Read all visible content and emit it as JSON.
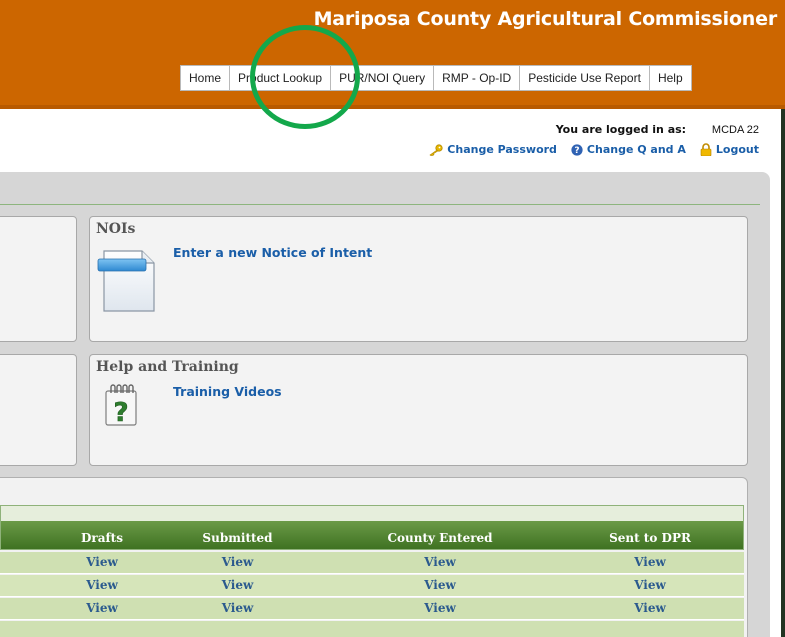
{
  "header": {
    "title": "Mariposa County Agricultural Commissioner",
    "background": "#cc6600"
  },
  "topnav": {
    "items": [
      "Home",
      "Product Lookup",
      "PUR/NOI Query",
      "RMP - Op-ID",
      "Pesticide Use Report",
      "Help"
    ]
  },
  "login": {
    "label": "You are logged in as:",
    "user": "MCDA 22",
    "change_password": "Change Password",
    "change_q_and_a": "Change Q and A",
    "logout": "Logout"
  },
  "cards": {
    "nois": {
      "title": "NOIs",
      "link": "Enter a new Notice of Intent",
      "icon": "document-icon"
    },
    "help": {
      "title": "Help and Training",
      "link": "Training Videos",
      "icon": "help-notepad-icon"
    }
  },
  "table": {
    "headers": [
      "Drafts",
      "Submitted",
      "County Entered",
      "Sent to DPR"
    ],
    "rows": [
      [
        "View",
        "View",
        "View",
        "View"
      ],
      [
        "View",
        "View",
        "View",
        "View"
      ],
      [
        "View",
        "View",
        "View",
        "View"
      ]
    ]
  },
  "colors": {
    "accent": "#cc6600",
    "link": "#1a5ea8",
    "table_header": "#4a7d2b",
    "table_row": "#d0e1b4",
    "annotation": "#13a84b"
  }
}
